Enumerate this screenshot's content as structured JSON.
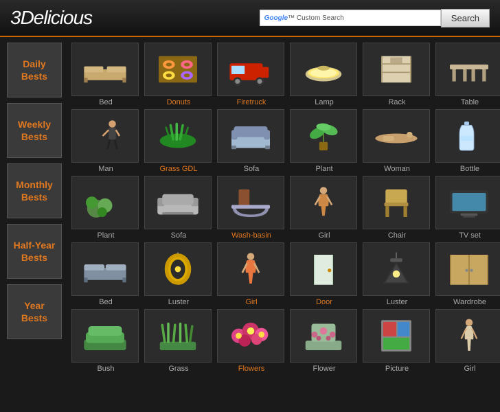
{
  "header": {
    "logo_3": "3",
    "logo_rest": "Delicious",
    "google_label": "Google™ Custom Search",
    "search_button": "Search"
  },
  "sidebar": {
    "items": [
      {
        "id": "daily",
        "label": "Daily\nBests"
      },
      {
        "id": "weekly",
        "label": "Weekly\nBests"
      },
      {
        "id": "monthly",
        "label": "Monthly\nBests"
      },
      {
        "id": "halfyear",
        "label": "Half-Year\nBests"
      },
      {
        "id": "year",
        "label": "Year\nBests"
      }
    ]
  },
  "rows": [
    {
      "id": "daily",
      "items": [
        {
          "label": "Bed",
          "color": "normal",
          "icon": "bed"
        },
        {
          "label": "Donuts",
          "color": "orange",
          "icon": "donuts"
        },
        {
          "label": "Firetruck",
          "color": "orange",
          "icon": "firetruck"
        },
        {
          "label": "Lamp",
          "color": "normal",
          "icon": "lamp"
        },
        {
          "label": "Rack",
          "color": "normal",
          "icon": "rack"
        },
        {
          "label": "Table",
          "color": "normal",
          "icon": "table"
        }
      ]
    },
    {
      "id": "weekly",
      "items": [
        {
          "label": "Man",
          "color": "normal",
          "icon": "man"
        },
        {
          "label": "Grass GDL",
          "color": "orange",
          "icon": "grass_gdl"
        },
        {
          "label": "Sofa",
          "color": "normal",
          "icon": "sofa"
        },
        {
          "label": "Plant",
          "color": "normal",
          "icon": "plant"
        },
        {
          "label": "Woman",
          "color": "normal",
          "icon": "woman"
        },
        {
          "label": "Bottle",
          "color": "normal",
          "icon": "bottle"
        }
      ]
    },
    {
      "id": "monthly",
      "items": [
        {
          "label": "Plant",
          "color": "normal",
          "icon": "plant2"
        },
        {
          "label": "Sofa",
          "color": "normal",
          "icon": "sofa2"
        },
        {
          "label": "Wash-basin",
          "color": "orange",
          "icon": "washbasin"
        },
        {
          "label": "Girl",
          "color": "normal",
          "icon": "girl"
        },
        {
          "label": "Chair",
          "color": "normal",
          "icon": "chair"
        },
        {
          "label": "TV set",
          "color": "normal",
          "icon": "tvset"
        }
      ]
    },
    {
      "id": "halfyear",
      "items": [
        {
          "label": "Bed",
          "color": "normal",
          "icon": "bed2"
        },
        {
          "label": "Luster",
          "color": "normal",
          "icon": "luster"
        },
        {
          "label": "Girl",
          "color": "orange",
          "icon": "girl2"
        },
        {
          "label": "Door",
          "color": "orange",
          "icon": "door"
        },
        {
          "label": "Luster",
          "color": "normal",
          "icon": "luster2"
        },
        {
          "label": "Wardrobe",
          "color": "normal",
          "icon": "wardrobe"
        }
      ]
    },
    {
      "id": "year",
      "items": [
        {
          "label": "Bush",
          "color": "normal",
          "icon": "bush"
        },
        {
          "label": "Grass",
          "color": "normal",
          "icon": "grass"
        },
        {
          "label": "Flowers",
          "color": "orange",
          "icon": "flowers"
        },
        {
          "label": "Flower",
          "color": "normal",
          "icon": "flower"
        },
        {
          "label": "Picture",
          "color": "normal",
          "icon": "picture"
        },
        {
          "label": "Girl",
          "color": "normal",
          "icon": "girl3"
        }
      ]
    }
  ]
}
